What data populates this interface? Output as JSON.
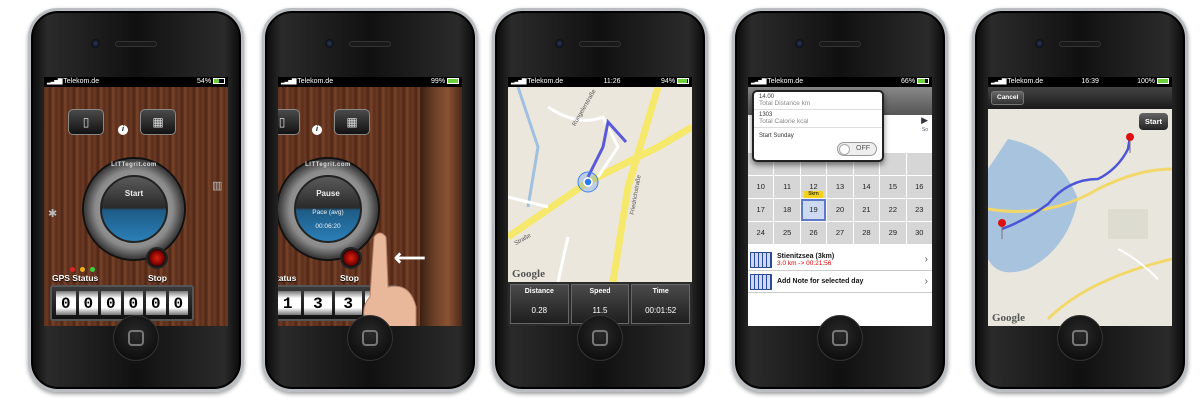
{
  "phones": [
    {
      "status": {
        "carrier": "Telekom.de",
        "time": "",
        "battery": "54%"
      },
      "app": {
        "brand": "LITTegrit.com",
        "start_label": "Start",
        "gps_status_label": "GPS Status",
        "stop_label": "Stop",
        "counter_digits": [
          "0",
          "0",
          "0",
          "0",
          "0",
          "0"
        ]
      }
    },
    {
      "status": {
        "carrier": "Telekom.de",
        "time": "",
        "battery": "99%"
      },
      "app": {
        "brand": "LITTegrit.com",
        "pause_label": "Pause",
        "pace_label": "Pace (avg)",
        "pace_value": "00:06:20",
        "gps_status_label": "tatus",
        "stop_label": "Stop",
        "counter_digits": [
          "1",
          "3",
          "3",
          "4"
        ]
      }
    },
    {
      "status": {
        "carrier": "Telekom.de",
        "time": "11:26",
        "battery": "94%"
      },
      "map": {
        "street_labels": [
          "Rüngelerstraße",
          "Straße",
          "Friedrichstraße"
        ],
        "google": "Google",
        "stats": [
          {
            "label": "Distance",
            "value": "0.28"
          },
          {
            "label": "Speed",
            "value": "11.5"
          },
          {
            "label": "Time",
            "value": "00:01:52"
          }
        ]
      }
    },
    {
      "status": {
        "carrier": "Telekom.de",
        "time": "",
        "battery": "66%"
      },
      "calendar": {
        "popover": {
          "distance_value": "14.00",
          "distance_label": "Total Distance km",
          "calorie_value": "1303",
          "calorie_label": "Total Calorie kcal",
          "start_sunday_label": "Start Sunday",
          "toggle": "OFF"
        },
        "weekday_hint": "So",
        "days": [
          "",
          "",
          "",
          "",
          "",
          "",
          "",
          "",
          "",
          "",
          "",
          "",
          "",
          "",
          "10",
          "11",
          "12",
          "13",
          "14",
          "15",
          "16",
          "17",
          "18",
          "19",
          "20",
          "21",
          "22",
          "23",
          "24",
          "25",
          "26",
          "27",
          "28",
          "29",
          "30"
        ],
        "badge_5km": "5km",
        "list": [
          {
            "title": "Stienitzsea (3km)",
            "subtitle": "3.0 km -> 00:21:56"
          },
          {
            "title": "Add Note for selected day",
            "subtitle": ""
          }
        ]
      }
    },
    {
      "status": {
        "carrier": "Telekom.de",
        "time": "16:39",
        "battery": "100%"
      },
      "route": {
        "cancel": "Cancel",
        "start": "Start",
        "google": "Google"
      }
    }
  ]
}
